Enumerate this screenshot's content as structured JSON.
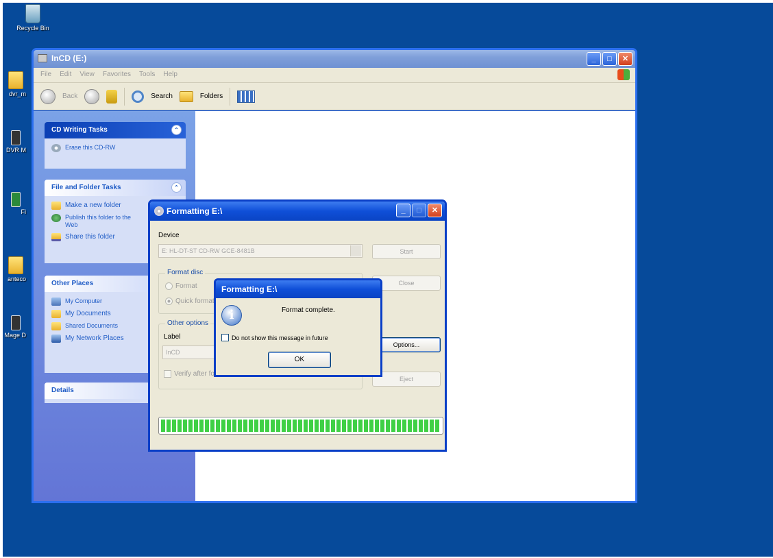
{
  "desktop": {
    "icons": [
      {
        "label": "Recycle Bin"
      },
      {
        "label": "dvr_m"
      },
      {
        "label": "DVR M"
      },
      {
        "label": "Fi"
      },
      {
        "label": "anteco"
      },
      {
        "label": "Mage D"
      }
    ]
  },
  "explorer": {
    "title": "InCD (E:)",
    "menu": [
      "File",
      "Edit",
      "View",
      "Favorites",
      "Tools",
      "Help"
    ],
    "toolbar": {
      "back_label": "Back",
      "search_label": "Search",
      "folders_label": "Folders"
    },
    "panels": {
      "cd_writing": {
        "title": "CD Writing Tasks",
        "items": [
          "Erase this CD-RW"
        ]
      },
      "file_folder": {
        "title": "File and Folder Tasks",
        "items": [
          "Make a new folder",
          "Publish this folder to the Web",
          "Share this folder"
        ]
      },
      "other_places": {
        "title": "Other Places",
        "items": [
          "My Computer",
          "My Documents",
          "Shared Documents",
          "My Network Places"
        ]
      },
      "details": {
        "title": "Details"
      }
    }
  },
  "format_dialog": {
    "title": "Formatting E:\\",
    "device_label": "Device",
    "device_value": "E: HL-DT-ST CD-RW GCE-8481B",
    "format_disc_label": "Format disc",
    "option_format": "Format",
    "option_quick": "Quick format",
    "other_options_label": "Other options",
    "label_label": "Label",
    "label_value": "InCD",
    "verify_label": "Verify after format",
    "buttons": {
      "start": "Start",
      "close": "Close",
      "options": "Options...",
      "eject": "Eject"
    },
    "progress": 1.0
  },
  "message_box": {
    "title": "Formatting E:\\",
    "message": "Format complete.",
    "checkbox_label": "Do not show this message in future",
    "ok_label": "OK"
  }
}
